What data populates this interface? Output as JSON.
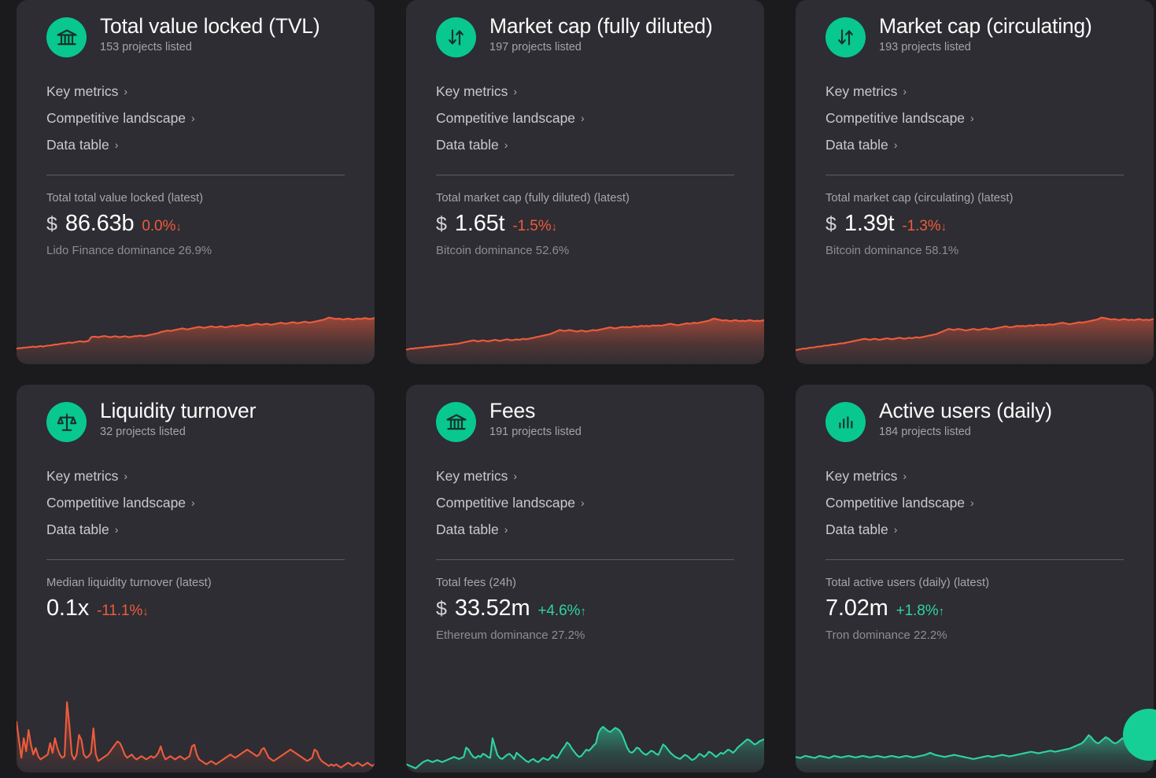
{
  "theme": {
    "page_bg": "#1b1b1e",
    "card_bg": "#2d2d33",
    "accent_green": "#08c88f",
    "line_orange": "#ef5b3c",
    "line_green": "#2fd39f",
    "text_primary": "#ffffff",
    "text_muted": "#a3a3a8"
  },
  "common": {
    "links": [
      {
        "label": "Key metrics",
        "chevron": "chevron-right-icon"
      },
      {
        "label": "Competitive landscape",
        "chevron": "chevron-right-icon"
      },
      {
        "label": "Data table",
        "chevron": "chevron-right-icon"
      }
    ],
    "down_arrow": "↓",
    "up_arrow": "↑"
  },
  "floating_button": {
    "name": "help-chat-button",
    "color": "#16cf97"
  },
  "cards": [
    {
      "id": "total-value-locked",
      "icon": "bank-icon",
      "title": "Total value locked (TVL)",
      "subtitle": "153 projects listed",
      "links": [
        "Key metrics",
        "Competitive landscape",
        "Data table"
      ],
      "stat_label": "Total total value locked (latest)",
      "currency": "$",
      "value": "86.63b",
      "delta": "0.0%",
      "delta_dir": "down",
      "dominance": "Lido Finance dominance 26.9%",
      "spark_color": "#ef5b3c"
    },
    {
      "id": "market-cap-fully-diluted",
      "icon": "exchange-arrows-icon",
      "title": "Market cap (fully diluted)",
      "subtitle": "197 projects listed",
      "links": [
        "Key metrics",
        "Competitive landscape",
        "Data table"
      ],
      "stat_label": "Total market cap (fully diluted) (latest)",
      "currency": "$",
      "value": "1.65t",
      "delta": "-1.5%",
      "delta_dir": "down",
      "dominance": "Bitcoin dominance 52.6%",
      "spark_color": "#ef5b3c"
    },
    {
      "id": "market-cap-circulating",
      "icon": "exchange-arrows-icon",
      "title": "Market cap (circulating)",
      "subtitle": "193 projects listed",
      "links": [
        "Key metrics",
        "Competitive landscape",
        "Data table"
      ],
      "stat_label": "Total market cap (circulating) (latest)",
      "currency": "$",
      "value": "1.39t",
      "delta": "-1.3%",
      "delta_dir": "down",
      "dominance": "Bitcoin dominance 58.1%",
      "spark_color": "#ef5b3c"
    },
    {
      "id": "liquidity-turnover",
      "icon": "scales-icon",
      "title": "Liquidity turnover",
      "subtitle": "32 projects listed",
      "links": [
        "Key metrics",
        "Competitive landscape",
        "Data table"
      ],
      "stat_label": "Median liquidity turnover (latest)",
      "currency": "",
      "value": "0.1x",
      "delta": "-11.1%",
      "delta_dir": "down",
      "dominance": "",
      "spark_color": "#ef5b3c"
    },
    {
      "id": "fees",
      "icon": "bank-icon",
      "title": "Fees",
      "subtitle": "191 projects listed",
      "links": [
        "Key metrics",
        "Competitive landscape",
        "Data table"
      ],
      "stat_label": "Total fees (24h)",
      "currency": "$",
      "value": "33.52m",
      "delta": "+4.6%",
      "delta_dir": "up",
      "dominance": "Ethereum dominance 27.2%",
      "spark_color": "#2fd39f"
    },
    {
      "id": "active-users-daily",
      "icon": "bar-chart-icon",
      "title": "Active users (daily)",
      "subtitle": "184 projects listed",
      "links": [
        "Key metrics",
        "Competitive landscape",
        "Data table"
      ],
      "stat_label": "Total active users (daily) (latest)",
      "currency": "",
      "value": "7.02m",
      "delta": "+1.8%",
      "delta_dir": "up",
      "dominance": "Tron dominance 22.2%",
      "spark_color": "#2fd39f"
    }
  ],
  "chart_data": [
    {
      "type": "area",
      "title": "Total value locked (TVL) sparkline",
      "id": "tvl-sparkline",
      "color": "#ef5b3c",
      "ylim": [
        0,
        100
      ],
      "values": [
        30,
        31,
        31,
        32,
        32,
        33,
        33,
        34,
        33,
        34,
        35,
        34,
        35,
        36,
        36,
        37,
        38,
        38,
        39,
        40,
        40,
        41,
        42,
        41,
        42,
        43,
        44,
        44,
        43,
        44,
        45,
        52,
        53,
        53,
        52,
        53,
        54,
        54,
        53,
        52,
        53,
        54,
        53,
        52,
        53,
        54,
        53,
        52,
        53,
        54,
        54,
        55,
        55,
        54,
        55,
        56,
        57,
        58,
        59,
        60,
        62,
        63,
        64,
        65,
        64,
        65,
        66,
        67,
        68,
        69,
        68,
        67,
        68,
        69,
        70,
        71,
        72,
        71,
        70,
        71,
        72,
        73,
        72,
        71,
        72,
        73,
        72,
        71,
        72,
        73,
        74,
        73,
        74,
        75,
        76,
        75,
        74,
        75,
        76,
        77,
        78,
        77,
        76,
        77,
        78,
        77,
        76,
        77,
        78,
        79,
        80,
        79,
        78,
        79,
        80,
        81,
        80,
        79,
        80,
        81,
        82,
        81,
        80,
        81,
        82,
        83,
        84,
        85,
        86,
        88,
        90,
        89,
        88,
        87,
        88,
        87,
        86,
        87,
        88,
        87,
        86,
        87,
        88,
        87,
        88,
        89,
        88,
        87,
        88,
        89
      ]
    },
    {
      "type": "area",
      "title": "Market cap (fully diluted) sparkline",
      "id": "mcap-fd-sparkline",
      "color": "#ef5b3c",
      "ylim": [
        0,
        100
      ],
      "values": [
        28,
        29,
        30,
        30,
        31,
        31,
        32,
        32,
        33,
        33,
        34,
        34,
        35,
        35,
        36,
        36,
        37,
        37,
        38,
        38,
        39,
        39,
        40,
        41,
        42,
        43,
        44,
        45,
        46,
        45,
        44,
        45,
        46,
        45,
        44,
        45,
        46,
        47,
        46,
        45,
        46,
        47,
        48,
        47,
        46,
        47,
        48,
        47,
        48,
        49,
        48,
        49,
        50,
        51,
        52,
        53,
        54,
        55,
        56,
        57,
        58,
        60,
        62,
        64,
        66,
        65,
        64,
        65,
        66,
        65,
        64,
        63,
        64,
        65,
        64,
        63,
        64,
        65,
        66,
        65,
        66,
        67,
        68,
        69,
        70,
        71,
        70,
        69,
        70,
        71,
        72,
        71,
        72,
        71,
        72,
        73,
        72,
        73,
        74,
        73,
        74,
        73,
        74,
        75,
        74,
        75,
        74,
        75,
        76,
        77,
        78,
        77,
        76,
        75,
        76,
        77,
        78,
        79,
        78,
        79,
        80,
        79,
        80,
        81,
        82,
        83,
        84,
        86,
        88,
        87,
        86,
        85,
        84,
        85,
        84,
        83,
        84,
        85,
        84,
        83,
        84,
        83,
        84,
        85,
        84,
        83,
        84,
        83,
        84,
        85
      ]
    },
    {
      "type": "area",
      "title": "Market cap (circulating) sparkline",
      "id": "mcap-circ-sparkline",
      "color": "#ef5b3c",
      "ylim": [
        0,
        100
      ],
      "values": [
        27,
        28,
        29,
        30,
        30,
        31,
        32,
        32,
        33,
        34,
        34,
        35,
        36,
        36,
        37,
        38,
        38,
        39,
        40,
        40,
        41,
        42,
        43,
        44,
        45,
        46,
        47,
        48,
        49,
        48,
        47,
        48,
        49,
        48,
        47,
        48,
        49,
        50,
        49,
        48,
        49,
        50,
        51,
        50,
        49,
        50,
        51,
        50,
        51,
        52,
        51,
        52,
        53,
        54,
        55,
        56,
        57,
        58,
        60,
        62,
        64,
        66,
        68,
        67,
        66,
        67,
        68,
        67,
        66,
        65,
        66,
        67,
        68,
        67,
        66,
        67,
        68,
        69,
        68,
        67,
        68,
        69,
        70,
        71,
        72,
        73,
        72,
        71,
        72,
        73,
        74,
        73,
        74,
        73,
        74,
        75,
        74,
        75,
        76,
        75,
        76,
        75,
        76,
        77,
        76,
        77,
        78,
        79,
        80,
        79,
        78,
        77,
        78,
        79,
        80,
        81,
        80,
        81,
        82,
        83,
        84,
        85,
        86,
        88,
        90,
        89,
        88,
        87,
        86,
        87,
        86,
        85,
        86,
        87,
        86,
        85,
        86,
        85,
        86,
        87,
        86,
        85,
        86,
        85,
        86,
        87
      ]
    },
    {
      "type": "area",
      "title": "Median liquidity turnover sparkline",
      "id": "liquidity-sparkline",
      "color": "#ef5b3c",
      "ylim": [
        0,
        100
      ],
      "values": [
        62,
        40,
        18,
        42,
        26,
        52,
        34,
        22,
        30,
        20,
        16,
        18,
        20,
        22,
        36,
        24,
        42,
        30,
        22,
        18,
        20,
        86,
        58,
        22,
        16,
        22,
        46,
        40,
        22,
        18,
        20,
        24,
        54,
        22,
        14,
        16,
        18,
        20,
        22,
        26,
        30,
        34,
        38,
        36,
        30,
        22,
        18,
        20,
        22,
        18,
        16,
        18,
        20,
        18,
        16,
        18,
        20,
        18,
        20,
        24,
        32,
        22,
        16,
        18,
        20,
        18,
        16,
        18,
        20,
        18,
        16,
        18,
        20,
        32,
        34,
        22,
        16,
        14,
        12,
        10,
        12,
        14,
        12,
        10,
        12,
        14,
        16,
        18,
        20,
        22,
        20,
        18,
        20,
        22,
        24,
        26,
        28,
        26,
        24,
        22,
        20,
        22,
        28,
        30,
        24,
        18,
        16,
        14,
        16,
        18,
        20,
        22,
        24,
        26,
        28,
        26,
        24,
        22,
        20,
        18,
        16,
        14,
        16,
        18,
        28,
        26,
        18,
        14,
        12,
        10,
        8,
        10,
        8,
        10,
        8,
        6,
        8,
        10,
        12,
        10,
        8,
        10,
        12,
        10,
        8,
        10,
        12,
        10,
        8,
        10
      ]
    },
    {
      "type": "area",
      "title": "Total fees (24h) sparkline",
      "id": "fees-sparkline",
      "color": "#2fd39f",
      "ylim": [
        0,
        100
      ],
      "values": [
        16,
        14,
        12,
        10,
        8,
        12,
        16,
        20,
        22,
        24,
        22,
        20,
        22,
        24,
        22,
        20,
        22,
        24,
        26,
        28,
        30,
        28,
        26,
        28,
        30,
        48,
        44,
        36,
        30,
        28,
        32,
        30,
        36,
        34,
        30,
        28,
        66,
        50,
        34,
        28,
        26,
        30,
        34,
        36,
        32,
        26,
        38,
        34,
        30,
        26,
        22,
        20,
        24,
        26,
        22,
        20,
        24,
        28,
        26,
        24,
        28,
        34,
        30,
        28,
        36,
        44,
        50,
        58,
        54,
        46,
        40,
        34,
        30,
        32,
        38,
        44,
        42,
        46,
        52,
        56,
        76,
        84,
        88,
        84,
        80,
        78,
        82,
        86,
        84,
        80,
        72,
        60,
        48,
        40,
        38,
        42,
        48,
        46,
        40,
        36,
        34,
        38,
        42,
        40,
        36,
        34,
        44,
        54,
        50,
        44,
        38,
        34,
        30,
        28,
        26,
        30,
        34,
        32,
        28,
        24,
        26,
        30,
        36,
        34,
        30,
        34,
        40,
        38,
        34,
        30,
        34,
        38,
        36,
        40,
        44,
        42,
        38,
        42,
        48,
        52,
        56,
        60,
        64,
        62,
        58,
        54,
        56,
        60,
        62,
        64
      ]
    },
    {
      "type": "area",
      "title": "Total active users (daily) sparkline",
      "id": "active-users-sparkline",
      "color": "#2fd39f",
      "ylim": [
        0,
        100
      ],
      "values": [
        30,
        29,
        28,
        30,
        32,
        31,
        30,
        29,
        28,
        30,
        32,
        31,
        30,
        29,
        28,
        30,
        32,
        31,
        30,
        29,
        30,
        31,
        32,
        31,
        30,
        29,
        30,
        31,
        32,
        31,
        30,
        29,
        30,
        31,
        32,
        31,
        30,
        29,
        30,
        31,
        32,
        31,
        30,
        29,
        30,
        31,
        32,
        31,
        30,
        29,
        30,
        31,
        32,
        33,
        34,
        36,
        38,
        36,
        34,
        33,
        32,
        31,
        30,
        31,
        32,
        33,
        34,
        33,
        32,
        31,
        30,
        29,
        28,
        27,
        26,
        27,
        28,
        29,
        30,
        31,
        32,
        31,
        30,
        31,
        32,
        33,
        34,
        33,
        32,
        31,
        32,
        33,
        34,
        35,
        36,
        37,
        38,
        39,
        40,
        39,
        38,
        37,
        38,
        39,
        40,
        41,
        42,
        41,
        40,
        41,
        42,
        43,
        44,
        45,
        46,
        48,
        50,
        52,
        54,
        56,
        60,
        66,
        72,
        68,
        62,
        58,
        56,
        60,
        64,
        68,
        66,
        62,
        58,
        56,
        58,
        62,
        66,
        64,
        62,
        64,
        66,
        68,
        66,
        64,
        62,
        64,
        66,
        68,
        70,
        72
      ]
    }
  ]
}
